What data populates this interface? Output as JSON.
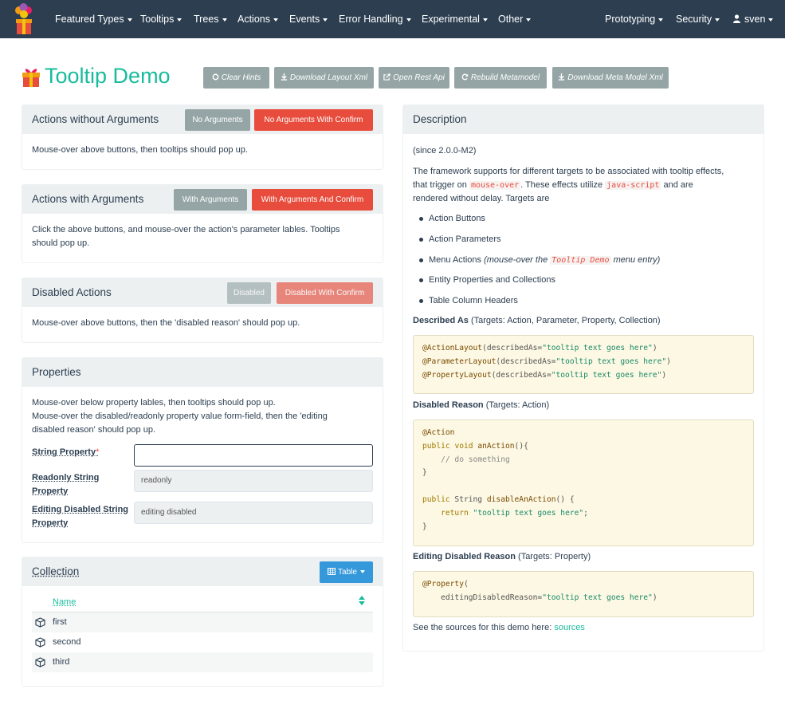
{
  "navbar": {
    "left_items": [
      "Featured Types",
      "Tooltips",
      "Trees",
      "Actions",
      "Events",
      "Error Handling",
      "Experimental",
      "Other"
    ],
    "right_items": [
      "Prototyping",
      "Security"
    ],
    "user": "sven"
  },
  "page": {
    "title": "Tooltip Demo",
    "toolbar": [
      "Clear Hints",
      "Download Layout Xml",
      "Open Rest Api",
      "Rebuild Metamodel",
      "Download Meta Model Xml"
    ]
  },
  "panels": {
    "no_args": {
      "title": "Actions without Arguments",
      "btn1": "No Arguments",
      "btn2": "No Arguments With Confirm",
      "body": "Mouse-over above buttons, then tooltips should pop up."
    },
    "with_args": {
      "title": "Actions with Arguments",
      "btn1": "With Arguments",
      "btn2": "With Arguments And Confirm",
      "body_line1": "Click the above buttons, and mouse-over the action's parameter lables. Tooltips",
      "body_line2": "should pop up."
    },
    "disabled": {
      "title": "Disabled Actions",
      "btn1": "Disabled",
      "btn2": "Disabled With Confirm",
      "body": "Mouse-over above buttons, then the 'disabled reason' should pop up."
    },
    "properties": {
      "title": "Properties",
      "line1": "Mouse-over below property lables, then tooltips should pop up.",
      "line2": "Mouse-over the disabled/readonly property value form-field, then the 'editing",
      "line3": "disabled reason' should pop up.",
      "string_label": "String Property",
      "string_value": "",
      "readonly_label_1": "Readonly String",
      "readonly_label_2": "Property",
      "readonly_value": "readonly",
      "editing_label_1": "Editing Disabled String",
      "editing_label_2": "Property",
      "editing_value": "editing disabled"
    },
    "collection": {
      "title": "Collection",
      "view_button": "Table",
      "column": "Name",
      "rows": [
        "first",
        "second",
        "third"
      ]
    }
  },
  "description": {
    "title": "Description",
    "since": "(since 2.0.0-M2)",
    "intro_1": "The framework supports for different targets to be associated with tooltip effects,",
    "intro_2a": "that trigger on",
    "intro_code1": "mouse-over",
    "intro_2b": ". These effects utilize",
    "intro_code2": "java-script",
    "intro_2c": "and are",
    "intro_3": "rendered without delay. Targets are",
    "bullets": [
      "Action Buttons",
      "Action Parameters",
      "Menu Actions",
      "Entity Properties and Collections",
      "Table Column Headers"
    ],
    "menu_note_a": "(mouse-over the",
    "menu_note_code": "Tooltip Demo",
    "menu_note_b": "menu entry)",
    "described_as_label": "Described As",
    "described_as_targets": "(Targets: Action, Parameter, Property, Collection)",
    "disabled_reason_label": "Disabled Reason",
    "disabled_reason_targets": "(Targets: Action)",
    "editing_reason_label": "Editing Disabled Reason",
    "editing_reason_targets": "(Targets: Property)",
    "sources_text": "See the sources for this demo here:",
    "sources_link": "sources"
  },
  "colors": {
    "navbar": "#2c3e50",
    "accent": "#18bc9c",
    "danger": "#e74c3c",
    "grey": "#95a5a6",
    "info": "#3498db"
  }
}
